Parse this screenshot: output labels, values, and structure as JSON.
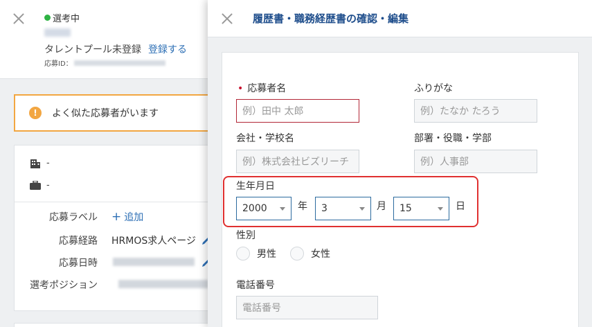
{
  "background": {
    "status_label": "選考中",
    "talent_pool_status": "タレントプール未登録",
    "register_link": "登録する",
    "application_id_label": "応募ID：",
    "duplicate_notice": "よく似た応募者がいます",
    "company_value": "-",
    "department_value": "-",
    "fields": {
      "label_label": "応募ラベル",
      "add_label": "追加",
      "route_label": "応募経路",
      "route_value": "HRMOS求人ページ",
      "date_label": "応募日時",
      "position_label": "選考ポジション"
    },
    "colors": {
      "accent": "#2d6fb5",
      "warning": "#f2a641",
      "status_green": "#2fb344"
    }
  },
  "drawer": {
    "title": "履歴書・職務経歴書の確認・編集",
    "form": {
      "name": {
        "label": "応募者名",
        "placeholder": "例）田中 太郎",
        "required": true
      },
      "furigana": {
        "label": "ふりがな",
        "placeholder": "例）たなか たろう"
      },
      "company": {
        "label": "会社・学校名",
        "placeholder": "例）株式会社ビズリーチ"
      },
      "department": {
        "label": "部署・役職・学部",
        "placeholder": "例）人事部"
      },
      "birthdate": {
        "label": "生年月日",
        "year": "2000",
        "year_unit": "年",
        "month": "3",
        "month_unit": "月",
        "day": "15",
        "day_unit": "日"
      },
      "gender": {
        "label": "性別",
        "options": [
          "男性",
          "女性"
        ]
      },
      "phone": {
        "label": "電話番号",
        "placeholder": "電話番号"
      }
    },
    "colors": {
      "title": "#1f4e8c",
      "error_border": "#b22636",
      "select_border": "#2b6a9e",
      "highlight": "#e03030"
    }
  }
}
